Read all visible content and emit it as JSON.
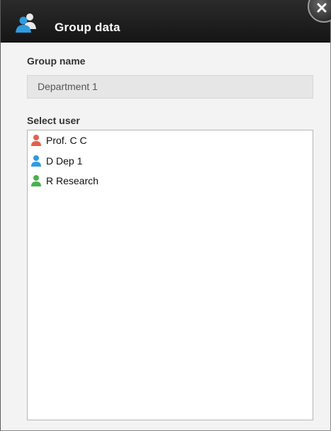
{
  "dialog": {
    "title": "Group data",
    "title_icon": "users-icon",
    "close_icon": "close-icon"
  },
  "group": {
    "label": "Group name",
    "value": "Department 1"
  },
  "users": {
    "label": "Select user",
    "items": [
      {
        "name": "Prof. C C",
        "icon": "user-icon",
        "color": "#e0614c"
      },
      {
        "name": "D Dep 1",
        "icon": "user-icon",
        "color": "#2f9be0"
      },
      {
        "name": "R Research",
        "icon": "user-icon",
        "color": "#4caf50"
      }
    ]
  },
  "colors": {
    "titlebar": "#1e1e1e",
    "body": "#f3f3f3"
  }
}
